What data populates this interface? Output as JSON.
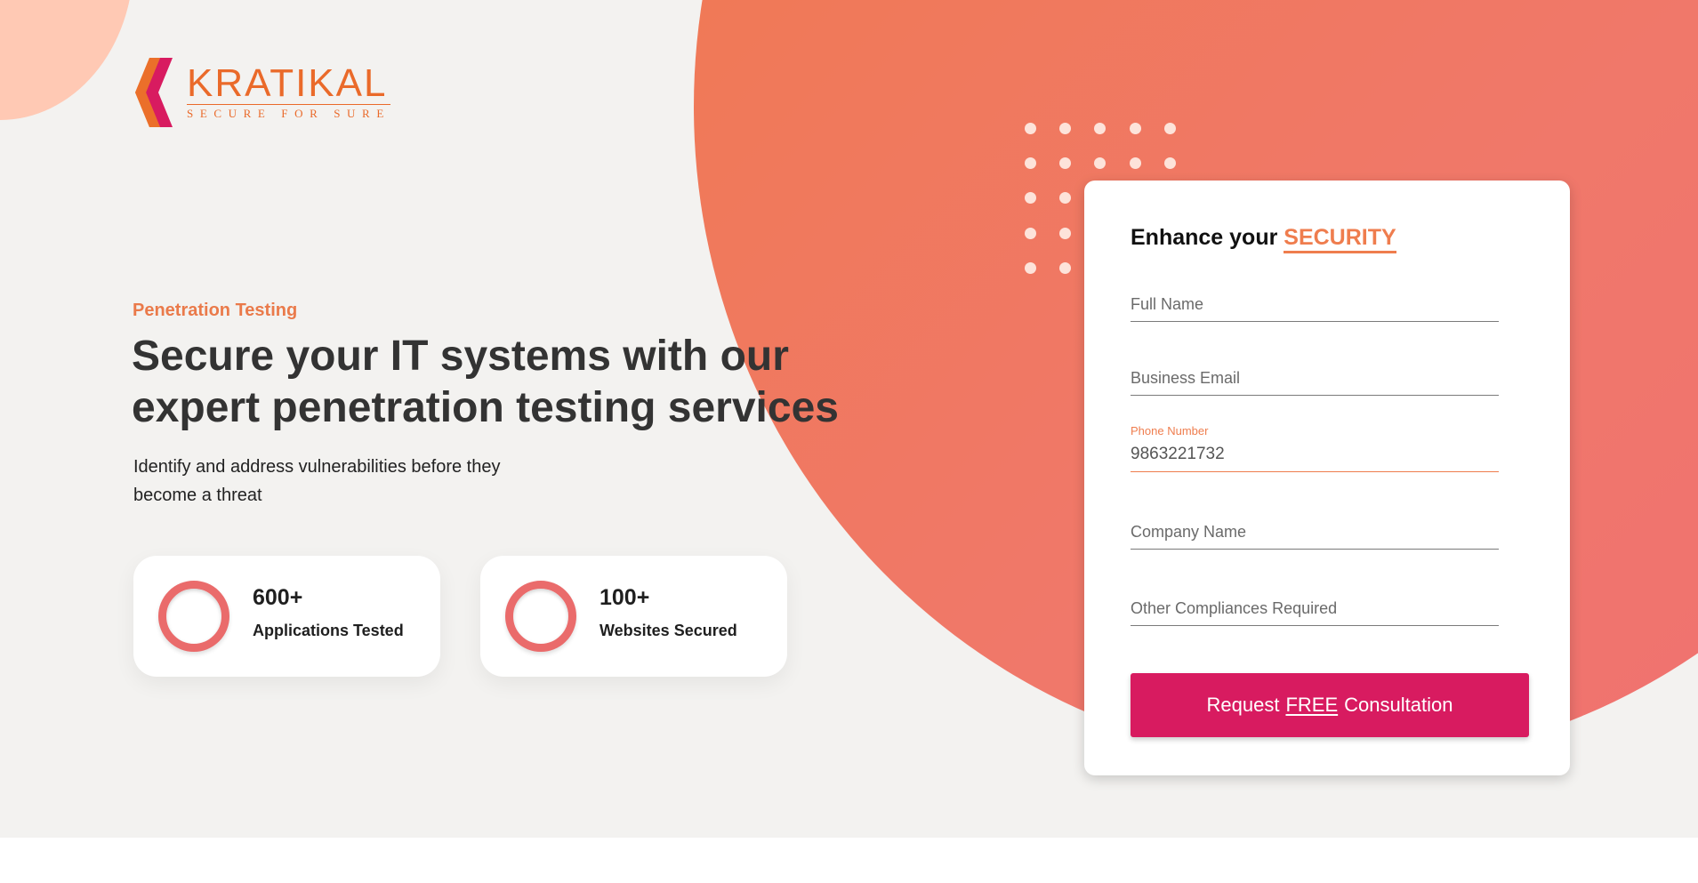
{
  "brand": {
    "name": "KRATIKAL",
    "tagline": "SECURE FOR SURE",
    "accent_color": "#ea6a2a"
  },
  "hero": {
    "eyebrow": "Penetration Testing",
    "headline": "Secure your IT systems with our expert penetration testing services",
    "subtext": "Identify and address vulnerabilities before they become a threat"
  },
  "stats": [
    {
      "value": "600+",
      "label": "Applications Tested",
      "icon": "ring-icon"
    },
    {
      "value": "100+",
      "label": "Websites Secured",
      "icon": "ring-icon"
    }
  ],
  "form": {
    "title_prefix": "Enhance your",
    "title_accent": "SECURITY",
    "fields": {
      "full_name": {
        "placeholder": "Full Name",
        "value": ""
      },
      "business_email": {
        "placeholder": "Business Email",
        "value": ""
      },
      "phone": {
        "label": "Phone Number",
        "value": "9863221732"
      },
      "company_name": {
        "placeholder": "Company Name",
        "value": ""
      },
      "compliances": {
        "placeholder": "Other Compliances Required",
        "value": ""
      }
    },
    "submit": {
      "prefix": "Request",
      "highlight": "FREE",
      "suffix": "Consultation",
      "color": "#d81b60"
    }
  },
  "theme": {
    "background": "#f3f2f0",
    "blob_color": "#f07a5a",
    "accent": "#ef7d4e"
  }
}
